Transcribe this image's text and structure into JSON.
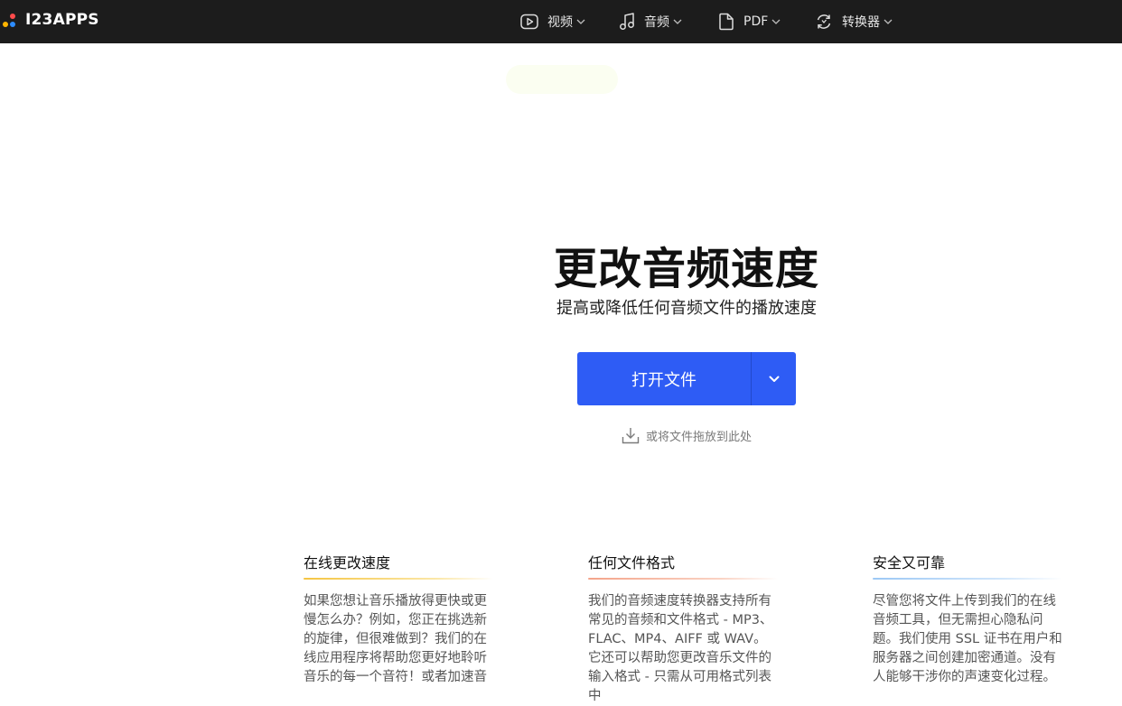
{
  "brand": {
    "name": "I23APPS"
  },
  "nav": [
    {
      "label": "视频",
      "icon": "video-play-icon"
    },
    {
      "label": "音频",
      "icon": "music-note-icon"
    },
    {
      "label": "PDF",
      "icon": "document-icon"
    },
    {
      "label": "转换器",
      "icon": "convert-icon"
    }
  ],
  "hero": {
    "title": "更改音频速度",
    "subtitle": "提高或降低任何音频文件的播放速度",
    "open_button_label": "打开文件",
    "drop_hint": "或将文件拖放到此处"
  },
  "features": [
    {
      "title": "在线更改速度",
      "accent": "#f5c542",
      "body": "如果您想让音乐播放得更快或更慢怎么办？例如，您正在挑选新的旋律，但很难做到？我们的在线应用程序将帮助您更好地聆听音乐的每一个音符！或者加速音"
    },
    {
      "title": "任何文件格式",
      "accent": "#f4a48a",
      "body": "我们的音频速度转换器支持所有常见的音频和文件格式 - MP3、FLAC、MP4、AIFF 或 WAV。它还可以帮助您更改音乐文件的输入格式 - 只需从可用格式列表中"
    },
    {
      "title": "安全又可靠",
      "accent": "#9cc8f5",
      "body": "尽管您将文件上传到我们的在线音频工具，但无需担心隐私问题。我们使用 SSL 证书在用户和服务器之间创建加密通道。没有人能够干涉你的声速变化过程。"
    }
  ],
  "colors": {
    "topbar": "#1c1c1c",
    "primary_button": "#2e5cf5"
  }
}
